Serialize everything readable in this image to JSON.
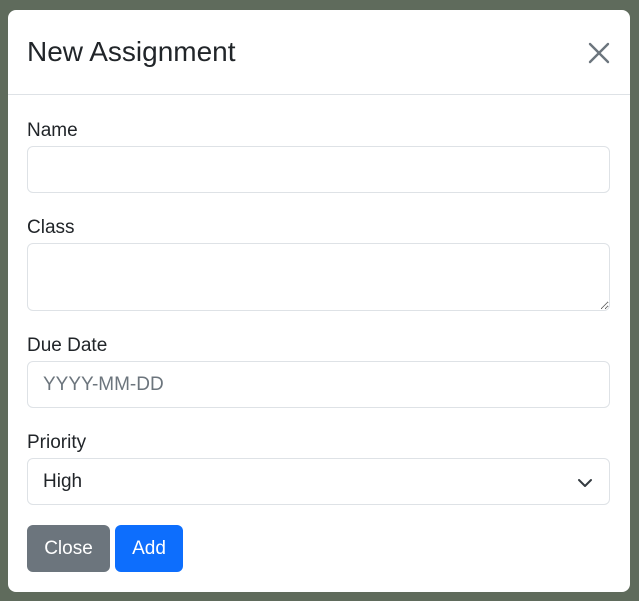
{
  "modal": {
    "title": "New Assignment",
    "close_icon": "close-x-icon"
  },
  "form": {
    "name": {
      "label": "Name",
      "value": "",
      "placeholder": ""
    },
    "class": {
      "label": "Class",
      "value": "",
      "placeholder": ""
    },
    "due_date": {
      "label": "Due Date",
      "value": "",
      "placeholder": "YYYY-MM-DD"
    },
    "priority": {
      "label": "Priority",
      "selected": "High",
      "icon": "chevron-down-icon"
    }
  },
  "footer": {
    "close_label": "Close",
    "add_label": "Add"
  },
  "colors": {
    "close_button": "#6c757d",
    "add_button": "#0d6efd"
  }
}
